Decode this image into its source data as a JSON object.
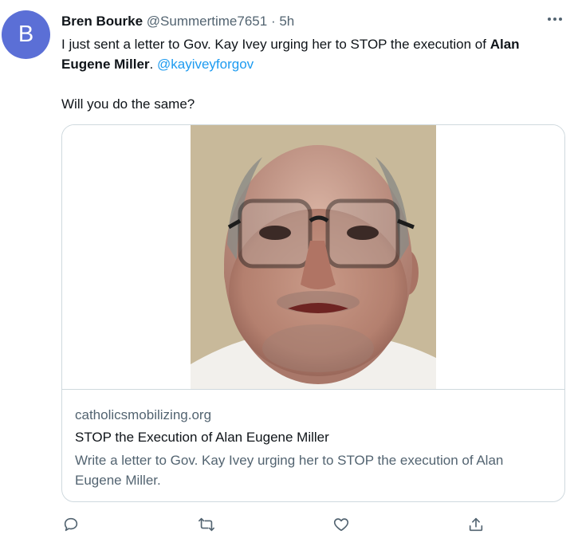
{
  "tweet": {
    "avatar_initial": "B",
    "author_name": "Bren Bourke",
    "author_handle": "@Summertime7651",
    "separator": "·",
    "time": "5h",
    "text_part1": "I just sent a letter to Gov. Kay Ivey urging her to STOP the execution of ",
    "text_bold": "Alan Eugene Miller",
    "text_part2": ". ",
    "mention": "@kayiveyforgov",
    "text_line2": "Will you do the same?",
    "more_label": "···"
  },
  "card": {
    "domain": "catholicsmobilizing.org",
    "title": "STOP the Execution of Alan Eugene Miller",
    "description": "Write a letter to Gov. Kay Ivey urging her to STOP the execution of Alan Eugene Miller."
  },
  "actions": [
    "reply-icon",
    "retweet-icon",
    "like-icon",
    "share-icon"
  ],
  "colors": {
    "avatar_bg": "#5b6fd6",
    "link": "#1d9bf0",
    "secondary_text": "#536471",
    "border": "#cfd9de"
  }
}
